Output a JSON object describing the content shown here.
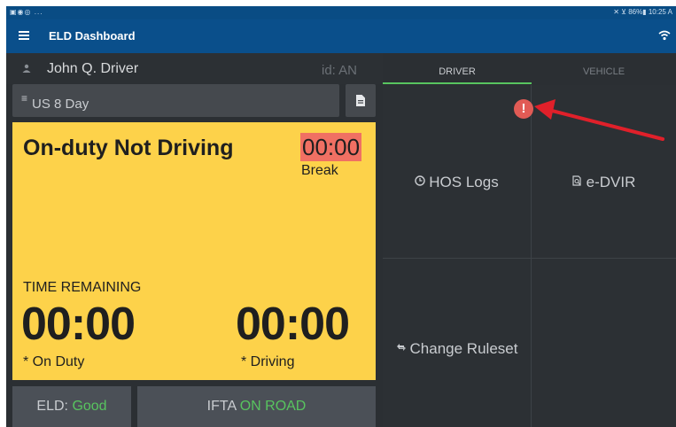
{
  "statusbar": {
    "left_icons": "▣◉◎ ...",
    "right": "✕ ⊻ 86%▮ 10:25 A"
  },
  "appbar": {
    "title": "ELD Dashboard"
  },
  "driver": {
    "name": "John Q. Driver",
    "id": "id: AN"
  },
  "ruleset": {
    "icon": "≡",
    "label": "US 8 Day"
  },
  "status": {
    "title": "On-duty Not Driving",
    "break_time": "00:00",
    "break_label": "Break",
    "remaining_label": "TIME REMAINING",
    "on_duty_time": "00:00",
    "on_duty_label": "* On Duty",
    "driving_time": "00:00",
    "driving_label": "* Driving"
  },
  "bottom": {
    "eld_label": "ELD:",
    "eld_value": "Good",
    "ifta_label": "IFTA",
    "ifta_value": "ON ROAD"
  },
  "tabs": {
    "driver": "DRIVER",
    "vehicle": "VEHICLE"
  },
  "tiles": {
    "hos_logs": "HOS Logs",
    "edvir": "e-DVIR",
    "change_ruleset": "Change Ruleset"
  },
  "alert": {
    "symbol": "!"
  },
  "colors": {
    "appbar": "#0a4f8b",
    "panel_yellow": "#fdd24a",
    "break_red": "#f07063",
    "good_green": "#58c45f",
    "alert_red": "#e15b55",
    "arrow_red": "#e0202a"
  },
  "icons": [
    "menu-icon",
    "wifi-icon",
    "person-icon",
    "list-icon",
    "document-icon",
    "clock-icon",
    "search-document-icon",
    "sync-icon",
    "alert-icon",
    "arrow-annotation"
  ]
}
